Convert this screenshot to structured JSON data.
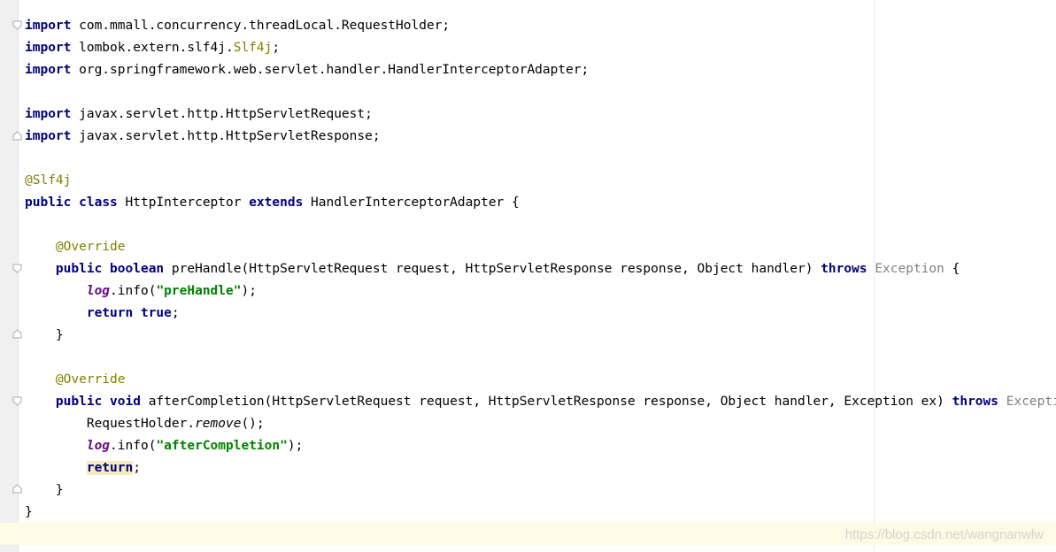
{
  "editor": {
    "lines": {
      "l1": {
        "kw": "import",
        "rest": " com.mmall.concurrency.threadLocal.RequestHolder;"
      },
      "l2": {
        "kw": "import",
        "pre": " lombok.extern.slf4j.",
        "ann": "Slf4j",
        "post": ";"
      },
      "l3": {
        "kw": "import",
        "rest": " org.springframework.web.servlet.handler.HandlerInterceptorAdapter;"
      },
      "l5": {
        "kw": "import",
        "rest": " javax.servlet.http.HttpServletRequest;"
      },
      "l6": {
        "kw": "import",
        "rest": " javax.servlet.http.HttpServletResponse;"
      },
      "l8": {
        "ann": "@Slf4j"
      },
      "l9": {
        "kw1": "public",
        "kw2": "class",
        "name": "HttpInterceptor",
        "kw3": "extends",
        "rest": "HandlerInterceptorAdapter {"
      },
      "l11": {
        "ann": "@Override"
      },
      "l12": {
        "kw1": "public",
        "kw2": "boolean",
        "sig": "preHandle(HttpServletRequest request, HttpServletResponse response, Object handler)",
        "kw3": "throws",
        "exc": "Exception",
        "brace": "{"
      },
      "l13": {
        "field": "log",
        "call": ".info(",
        "q1": "\"",
        "str": "preHandle",
        "q2": "\"",
        "end": ");"
      },
      "l14": {
        "kw1": "return",
        "kw2": "true",
        "end": ";"
      },
      "l15": {
        "text": "}"
      },
      "l17": {
        "ann": "@Override"
      },
      "l18": {
        "kw1": "public",
        "kw2": "void",
        "sig": "afterCompletion(HttpServletRequest request, HttpServletResponse response, Object handler, Exception ex)",
        "kw3": "throws",
        "exc": "Exception",
        "brace": "{"
      },
      "l19": {
        "cls": "RequestHolder.",
        "method": "remove",
        "end": "();"
      },
      "l20": {
        "field": "log",
        "call": ".info(",
        "q1": "\"",
        "str": "afterCompletion",
        "q2": "\"",
        "end": ");"
      },
      "l21": {
        "kw": "return",
        "end": ";"
      },
      "l22": {
        "text": "}"
      },
      "l23": {
        "text": "}"
      }
    }
  },
  "watermark": "https://blog.csdn.net/wangnanwlw",
  "colors": {
    "keyword": "#000080",
    "annotation": "#808000",
    "string": "#008000",
    "static_field": "#660e7a",
    "gray_type": "#808080",
    "caret_line": "#fffae3",
    "gutter": "#f0f0f0"
  }
}
